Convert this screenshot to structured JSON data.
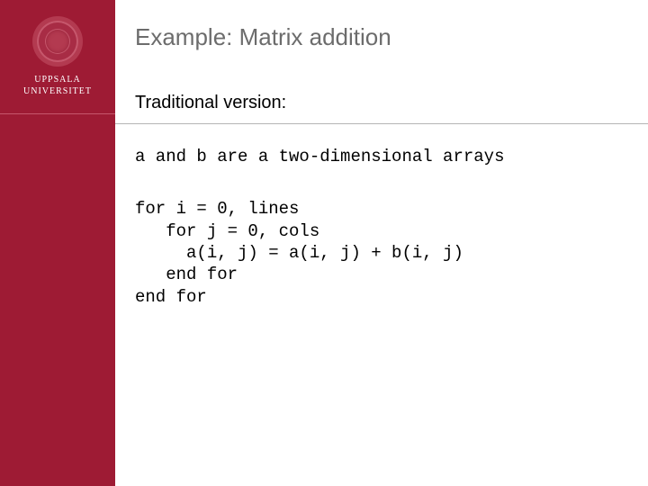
{
  "sidebar": {
    "university_line1": "UPPSALA",
    "university_line2": "UNIVERSITET"
  },
  "slide": {
    "title": "Example: Matrix  addition",
    "subtitle": "Traditional version:",
    "desc_line": "a and b are a two-dimensional arrays",
    "code_line1": "for i = 0, lines",
    "code_line2": "   for j = 0, cols",
    "code_line3": "     a(i, j) = a(i, j) + b(i, j)",
    "code_line4": "   end for",
    "code_line5": "end for"
  }
}
